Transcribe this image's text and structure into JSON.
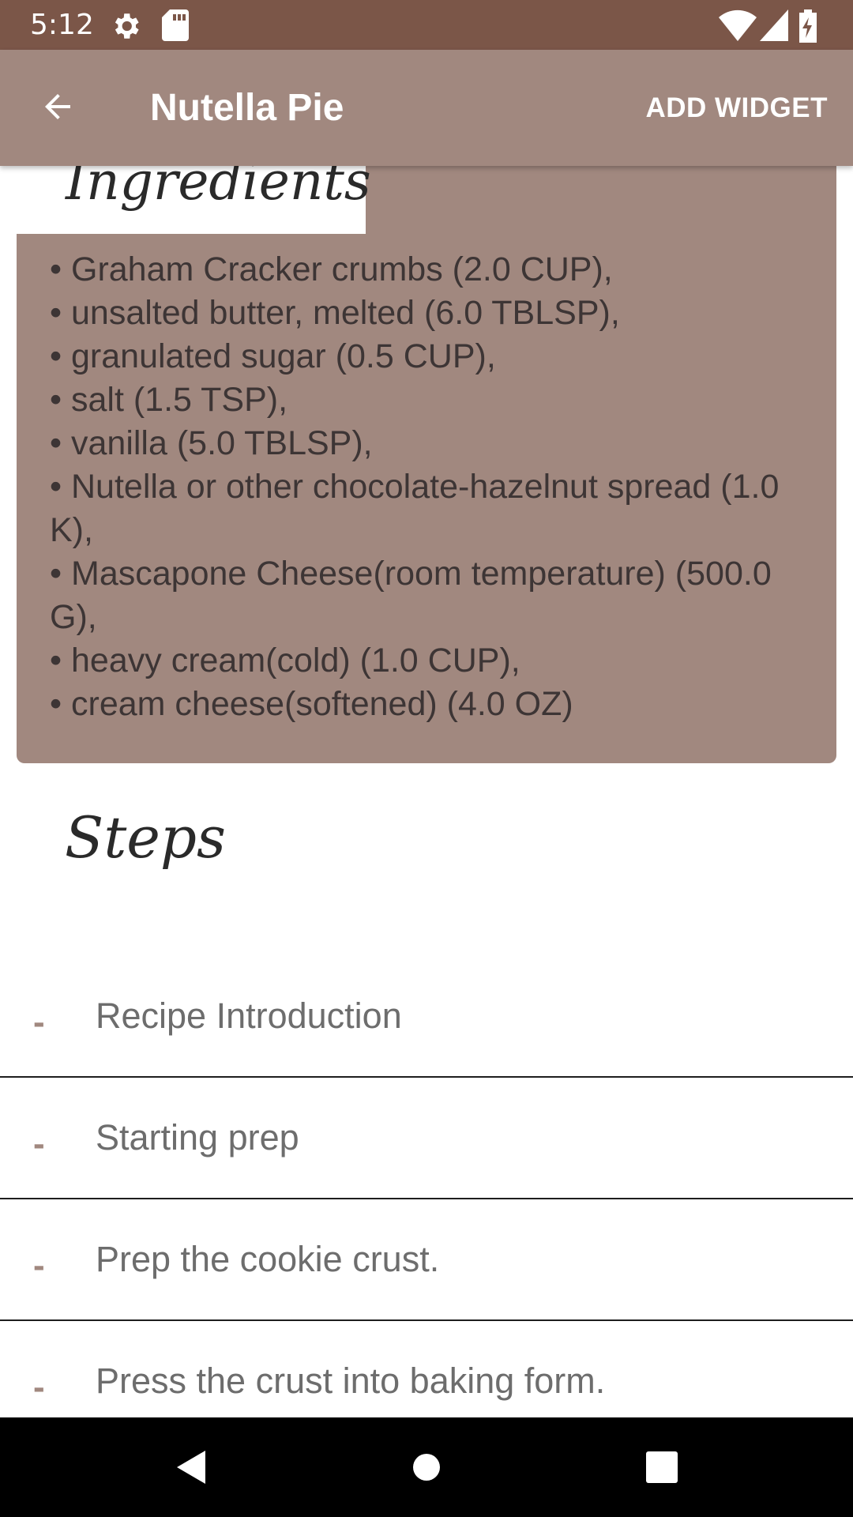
{
  "status_bar": {
    "time": "5:12",
    "icons": [
      "gear-icon",
      "sd-card-icon",
      "wifi-icon",
      "signal-icon",
      "battery-charging-icon"
    ]
  },
  "app_bar": {
    "title": "Nutella Pie",
    "action_label": "ADD WIDGET",
    "back_icon": "arrow-back-icon"
  },
  "ingredients": {
    "title": "Ingredients",
    "items": [
      "• Graham Cracker crumbs (2.0 CUP),",
      "• unsalted butter, melted (6.0 TBLSP),",
      "• granulated sugar (0.5 CUP),",
      "• salt (1.5 TSP),",
      "• vanilla (5.0 TBLSP),",
      "• Nutella or other chocolate-hazelnut spread (1.0 K),",
      "• Mascapone Cheese(room temperature) (500.0 G),",
      "• heavy cream(cold) (1.0 CUP),",
      "• cream cheese(softened) (4.0 OZ)"
    ]
  },
  "steps": {
    "title": "Steps",
    "bullet": "-",
    "items": [
      "Recipe Introduction",
      "Starting prep",
      "Prep the cookie crust.",
      "Press the crust into baking form."
    ]
  },
  "nav_bar": {
    "icons": [
      "nav-back-icon",
      "nav-home-icon",
      "nav-recents-icon"
    ]
  },
  "colors": {
    "status_bar": "#7b5648",
    "accent": "#a1887f",
    "nav_bar": "#000000"
  }
}
